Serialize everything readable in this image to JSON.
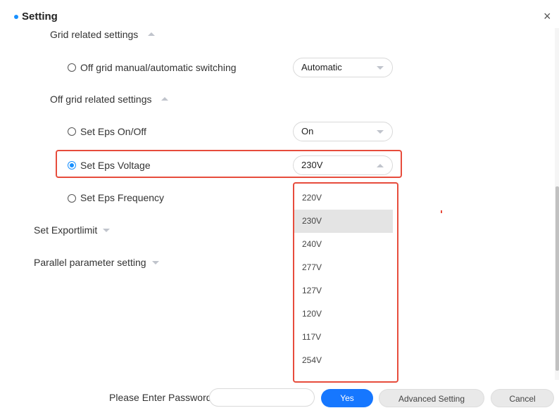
{
  "dialog": {
    "title": "Setting",
    "close_glyph": "×"
  },
  "sections": {
    "grid_related": {
      "label": "Grid related settings"
    },
    "off_grid_switch": {
      "label": "Off grid manual/automatic switching",
      "value": "Automatic"
    },
    "off_grid_related": {
      "label": "Off grid related settings"
    },
    "eps_onoff": {
      "label": "Set Eps On/Off",
      "value": "On"
    },
    "eps_voltage": {
      "label": "Set Eps Voltage",
      "value": "230V"
    },
    "eps_frequency": {
      "label": "Set Eps Frequency"
    },
    "export_limit": {
      "label": "Set Exportlimit"
    },
    "parallel": {
      "label": "Parallel parameter setting"
    }
  },
  "voltage_options": [
    "220V",
    "230V",
    "240V",
    "277V",
    "127V",
    "120V",
    "117V",
    "254V"
  ],
  "selected_voltage": "230V",
  "footer": {
    "password_label": "Please Enter Password",
    "password_value": "",
    "yes_label": "Yes",
    "advanced_label": "Advanced Setting",
    "cancel_label": "Cancel"
  },
  "colors": {
    "accent": "#1677ff",
    "highlight": "#e74c3c"
  }
}
